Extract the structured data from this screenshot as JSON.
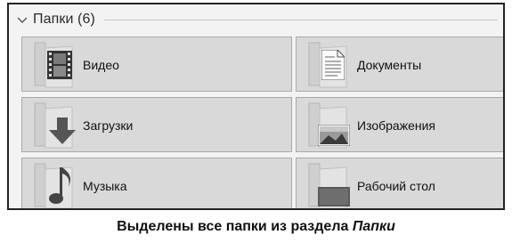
{
  "group": {
    "title": "Папки (6)"
  },
  "folders": [
    {
      "label": "Видео",
      "icon": "video-film-icon"
    },
    {
      "label": "Документы",
      "icon": "document-icon"
    },
    {
      "label": "Загрузки",
      "icon": "download-arrow-icon"
    },
    {
      "label": "Изображения",
      "icon": "picture-icon"
    },
    {
      "label": "Музыка",
      "icon": "music-note-icon"
    },
    {
      "label": "Рабочий стол",
      "icon": "desktop-icon"
    }
  ],
  "caption": {
    "main": "Выделены все папки из раздела",
    "emphasis": "Папки"
  }
}
